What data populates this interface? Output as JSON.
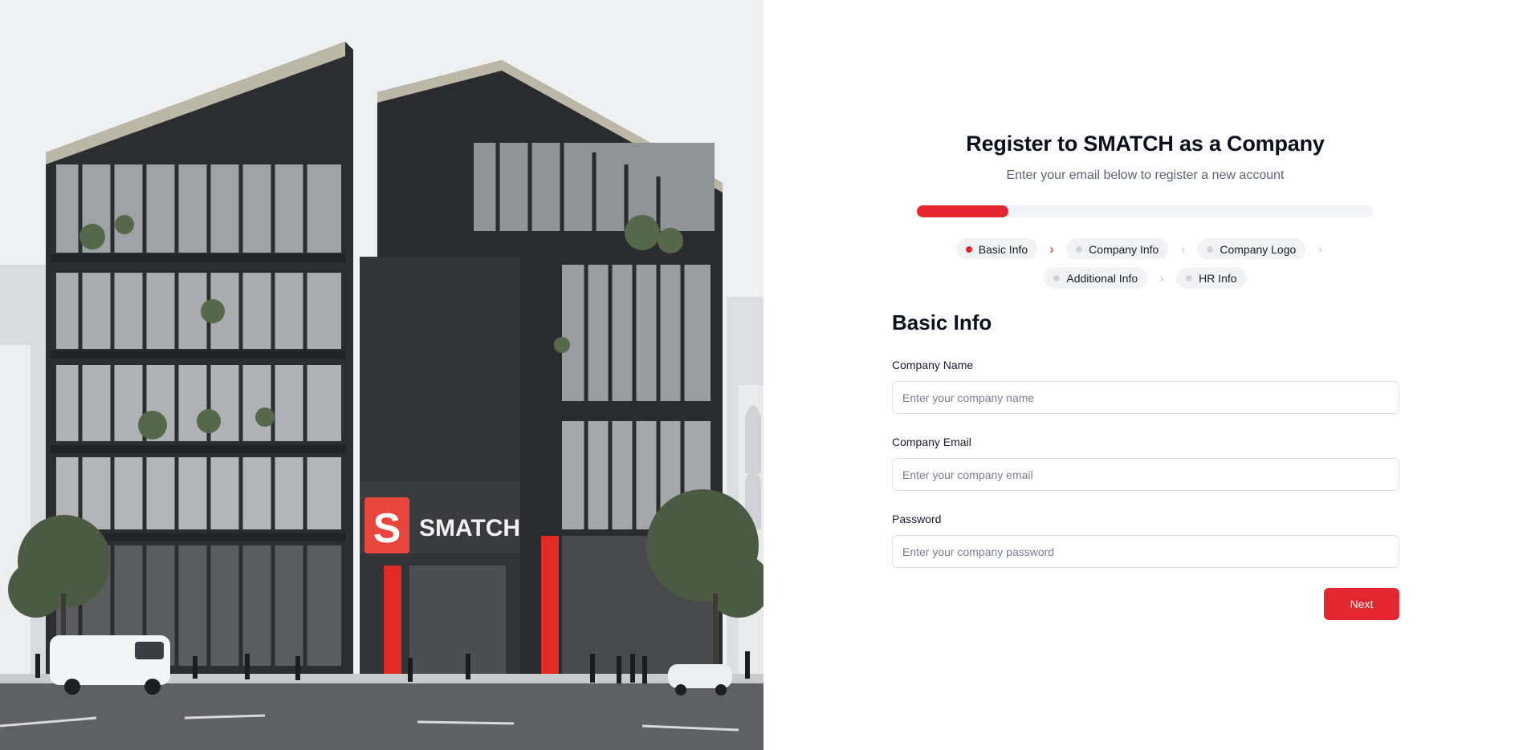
{
  "hero": {
    "sign_letter": "S",
    "sign_text": "SMATCH"
  },
  "header": {
    "title": "Register to SMATCH as a Company",
    "subtitle": "Enter your email below to register a new account"
  },
  "progress": {
    "fraction": 0.2
  },
  "steps": [
    {
      "label": "Basic Info",
      "active": true
    },
    {
      "label": "Company Info",
      "active": false
    },
    {
      "label": "Company Logo",
      "active": false
    },
    {
      "label": "Additional Info",
      "active": false
    },
    {
      "label": "HR Info",
      "active": false
    }
  ],
  "form": {
    "section_title": "Basic Info",
    "company_name": {
      "label": "Company Name",
      "value": "",
      "placeholder": "Enter your company name"
    },
    "company_email": {
      "label": "Company Email",
      "value": "",
      "placeholder": "Enter your company email"
    },
    "password": {
      "label": "Password",
      "value": "",
      "placeholder": "Enter your company password"
    },
    "next_label": "Next"
  },
  "colors": {
    "accent": "#e3262f",
    "track": "#f1f2f5",
    "pill": "#f2f3f5",
    "inactive_dot": "#d3d5db"
  },
  "icons": {
    "step_separator": "chevron-right-icon",
    "step_marker": "dot-icon"
  }
}
